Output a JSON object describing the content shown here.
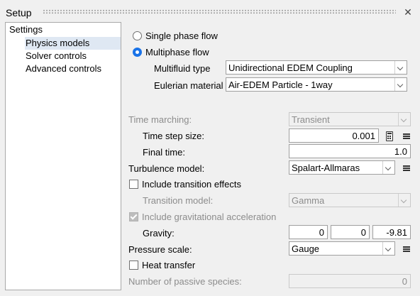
{
  "window": {
    "title": "Setup",
    "close_glyph": "✕"
  },
  "tree": {
    "header": "Settings",
    "items": [
      {
        "label": "Physics models",
        "selected": true
      },
      {
        "label": "Solver controls",
        "selected": false
      },
      {
        "label": "Advanced controls",
        "selected": false
      }
    ]
  },
  "flow": {
    "single_label": "Single phase flow",
    "multi_label": "Multiphase flow",
    "selected": "multi",
    "multifluid_type_label": "Multifluid type",
    "multifluid_type_value": "Unidirectional EDEM Coupling",
    "eulerian_label": "Eulerian material",
    "eulerian_value": "Air-EDEM Particle - 1way"
  },
  "time": {
    "marching_label": "Time marching:",
    "marching_value": "Transient",
    "step_label": "Time step size:",
    "step_value": "0.001",
    "final_label": "Final time:",
    "final_value": "1.0"
  },
  "turbulence": {
    "label": "Turbulence model:",
    "value": "Spalart-Allmaras",
    "include_transition_label": "Include transition effects",
    "include_transition_checked": false,
    "transition_model_label": "Transition model:",
    "transition_model_value": "Gamma"
  },
  "gravity": {
    "include_label": "Include gravitational acceleration",
    "include_checked": true,
    "label": "Gravity:",
    "x": "0",
    "y": "0",
    "z": "-9.81"
  },
  "pressure": {
    "label": "Pressure scale:",
    "value": "Gauge"
  },
  "heat": {
    "label": "Heat transfer",
    "checked": false
  },
  "species": {
    "label": "Number of passive species:",
    "value": "0"
  },
  "icons": {
    "menu": "hamburger-menu-icon",
    "calculator": "calculator-icon",
    "dropdown": "chevron-down-icon"
  }
}
